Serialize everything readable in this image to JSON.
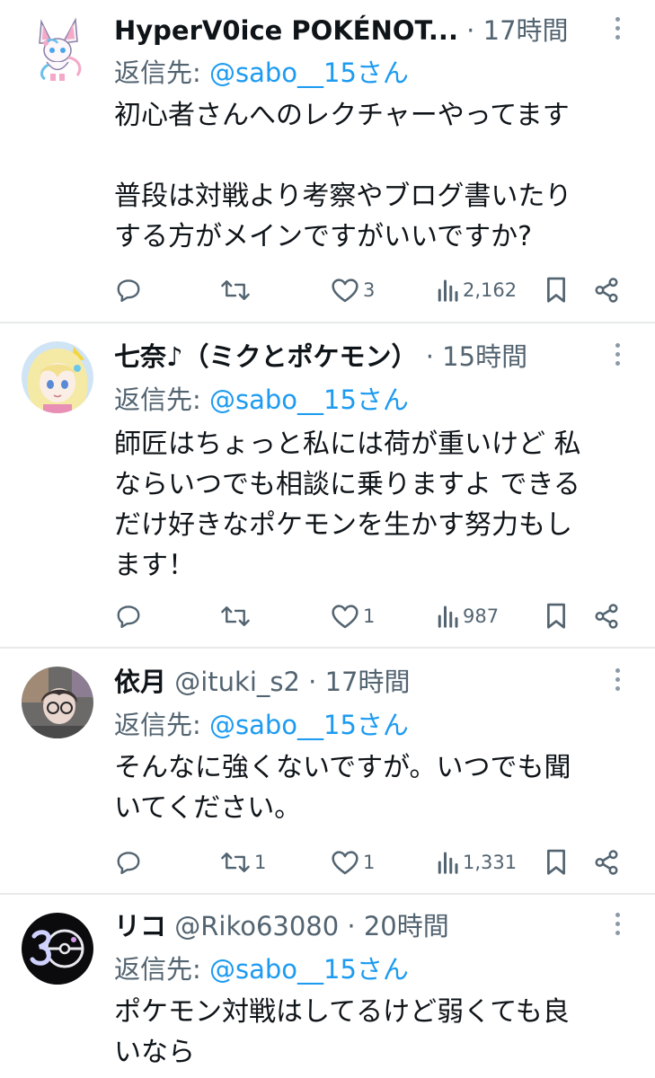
{
  "reply_prefix": "返信先: ",
  "tweets": [
    {
      "name": "HyperV0ice POKÉNOT...",
      "handle": "",
      "sep": " · ",
      "time": "17時間",
      "reply_to": "@sabo__15さん",
      "text": "初心者さんへのレクチャーやってます\n\n普段は対戦より考察やブログ書いたり\nする方がメインですがいいですか?",
      "replies": "",
      "retweets": "",
      "likes": "3",
      "views": "2,162",
      "avatar_icon": "sylveon-avatar"
    },
    {
      "name": "七奈♪（ミクとポケモン）",
      "handle": "",
      "sep": " · ",
      "time": "15時間",
      "reply_to": "@sabo__15さん",
      "text": "師匠はちょっと私には荷が重いけど 私\nならいつでも相談に乗りますよ できる\nだけ好きなポケモンを生かす努力もし\nます！",
      "replies": "",
      "retweets": "",
      "likes": "1",
      "views": "987",
      "avatar_icon": "anime-girl-avatar"
    },
    {
      "name": "依月",
      "handle": " @ituki_s2",
      "sep": " · ",
      "time": "17時間",
      "reply_to": "@sabo__15さん",
      "text": "そんなに強くないですが。いつでも聞\nいてください。",
      "replies": "",
      "retweets": "1",
      "likes": "1",
      "views": "1,331",
      "avatar_icon": "person-avatar"
    },
    {
      "name": "リコ",
      "handle": " @Riko63080",
      "sep": " · ",
      "time": "20時間",
      "reply_to": "@sabo__15さん",
      "text": "ポケモン対戦はしてるけど弱くても良\nいなら",
      "replies": "",
      "retweets": "",
      "likes": "",
      "views": "",
      "avatar_icon": "pokeball-30-avatar"
    }
  ],
  "colors": {
    "text": "#0f1419",
    "secondary": "#536471",
    "accent": "#1d9bf0",
    "divider": "#e7e9ea"
  }
}
